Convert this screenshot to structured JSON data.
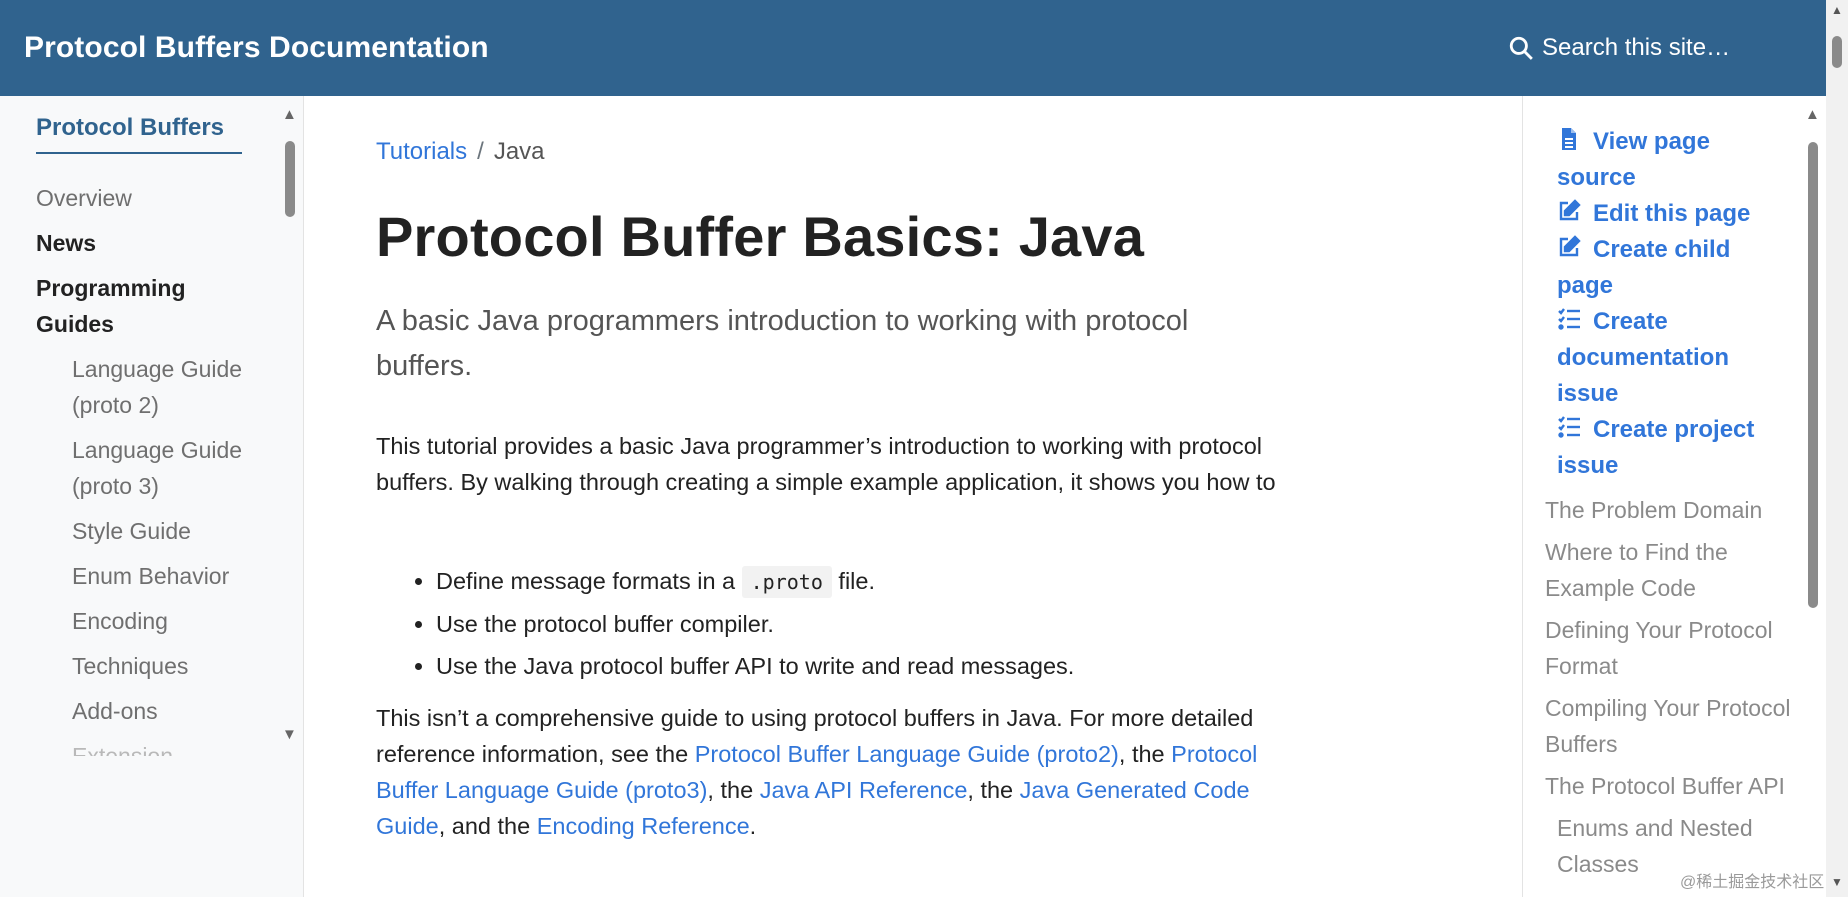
{
  "header": {
    "title": "Protocol Buffers Documentation",
    "search_placeholder": "Search this site…"
  },
  "left_sidebar": {
    "section_title": "Protocol Buffers",
    "items": [
      {
        "label": "Overview"
      },
      {
        "label": "News"
      },
      {
        "label": "Programming Guides"
      },
      {
        "label": "Language Guide (proto 2)"
      },
      {
        "label": "Language Guide (proto 3)"
      },
      {
        "label": "Style Guide"
      },
      {
        "label": "Enum Behavior"
      },
      {
        "label": "Encoding"
      },
      {
        "label": "Techniques"
      },
      {
        "label": "Add-ons"
      },
      {
        "label": "Extension"
      }
    ]
  },
  "breadcrumb": {
    "parent": "Tutorials",
    "separator": "/",
    "current": "Java"
  },
  "page": {
    "title": "Protocol Buffer Basics: Java",
    "lead": "A basic Java programmers introduction to working with protocol buffers.",
    "intro": "This tutorial provides a basic Java programmer’s introduction to working with protocol buffers. By walking through creating a simple example application, it shows you how to",
    "bullets": {
      "b1_pre": "Define message formats in a",
      "b1_code": ".proto",
      "b1_post": "file.",
      "b2": "Use the protocol buffer compiler.",
      "b3": "Use the Java protocol buffer API to write and read messages."
    },
    "para2": {
      "t1": "This isn’t a comprehensive guide to using protocol buffers in Java. For more detailed reference information, see the",
      "l1": "Protocol Buffer Language Guide (proto2)",
      "t2": ", the",
      "l2": "Protocol Buffer Language Guide (proto3)",
      "t3": ", the",
      "l3": "Java API Reference",
      "t4": ", the",
      "l4": "Java Generated Code Guide",
      "t5": ", and the",
      "l5": "Encoding Reference",
      "t6": "."
    }
  },
  "right_toc": {
    "actions": [
      {
        "label": "View page source",
        "icon": "file-icon"
      },
      {
        "label": "Edit this page",
        "icon": "edit-icon"
      },
      {
        "label": "Create child page",
        "icon": "edit-icon"
      },
      {
        "label": "Create documentation issue",
        "icon": "tasks-icon"
      },
      {
        "label": "Create project issue",
        "icon": "tasks-icon"
      }
    ],
    "links": [
      {
        "label": "The Problem Domain"
      },
      {
        "label": "Where to Find the Example Code"
      },
      {
        "label": "Defining Your Protocol Format"
      },
      {
        "label": "Compiling Your Protocol Buffers"
      },
      {
        "label": "The Protocol Buffer API"
      },
      {
        "label": "Enums and Nested Classes"
      }
    ]
  },
  "watermark": "@稀土掘金技术社区"
}
